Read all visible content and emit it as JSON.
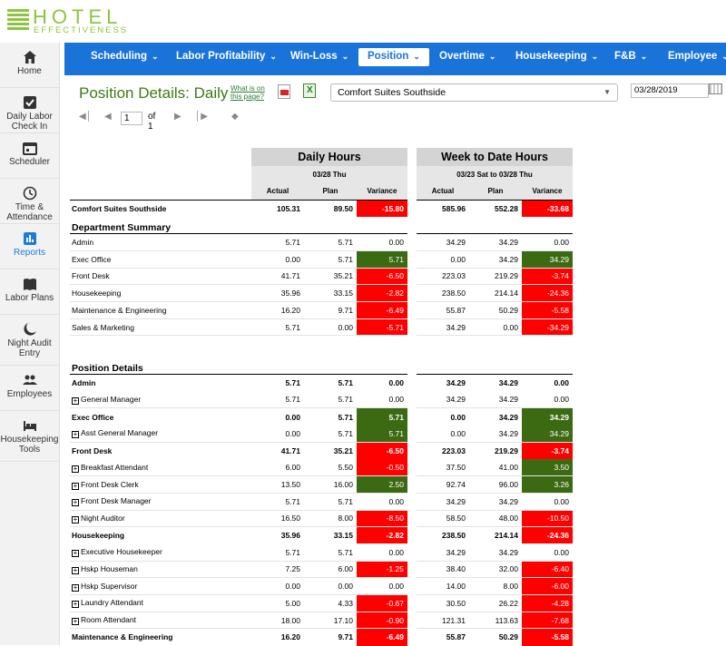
{
  "logo": {
    "title": "HOTEL",
    "subtitle": "EFFECTIVENESS"
  },
  "sidebar": [
    {
      "name": "home",
      "label": "Home"
    },
    {
      "name": "daily-labor-check-in",
      "label": "Daily Labor Check In"
    },
    {
      "name": "scheduler",
      "label": "Scheduler"
    },
    {
      "name": "time-attendance",
      "label": "Time & Attendance"
    },
    {
      "name": "reports",
      "label": "Reports"
    },
    {
      "name": "labor-plans",
      "label": "Labor Plans"
    },
    {
      "name": "night-audit-entry",
      "label": "Night Audit Entry"
    },
    {
      "name": "employees",
      "label": "Employees"
    },
    {
      "name": "housekeeping-tools",
      "label": "Housekeeping Tools"
    }
  ],
  "nav": {
    "scheduling": "Scheduling",
    "labor_profitability": "Labor Profitability",
    "win_loss": "Win-Loss",
    "position": "Position",
    "overtime": "Overtime",
    "housekeeping": "Housekeeping",
    "fb": "F&B",
    "employee": "Employee"
  },
  "page": {
    "title": "Position Details: Daily",
    "help_link": "What is on this page?",
    "property": "Comfort Suites Southside",
    "date": "03/28/2019"
  },
  "pager": {
    "page": "1",
    "of_label": "of 1"
  },
  "table": {
    "daily_title": "Daily Hours",
    "daily_date": "03/28 Thu",
    "wtd_title": "Week to Date Hours",
    "wtd_date": "03/23 Sat to 03/28 Thu",
    "col_actual": "Actual",
    "col_plan": "Plan",
    "col_variance": "Variance",
    "total": {
      "label": "Comfort Suites Southside",
      "v": [
        "105.31",
        "89.50",
        "-15.80",
        "585.96",
        "552.28",
        "-33.68"
      ]
    },
    "dept_summary_title": "Department Summary",
    "dept_summary": [
      {
        "label": "Admin",
        "v": [
          "5.71",
          "5.71",
          "0.00",
          "34.29",
          "34.29",
          "0.00"
        ]
      },
      {
        "label": "Exec Office",
        "v": [
          "0.00",
          "5.71",
          "5.71",
          "0.00",
          "34.29",
          "34.29"
        ]
      },
      {
        "label": "Front Desk",
        "v": [
          "41.71",
          "35.21",
          "-6.50",
          "223.03",
          "219.29",
          "-3.74"
        ]
      },
      {
        "label": "Housekeeping",
        "v": [
          "35.96",
          "33.15",
          "-2.82",
          "238.50",
          "214.14",
          "-24.36"
        ]
      },
      {
        "label": "Maintenance & Engineering",
        "v": [
          "16.20",
          "9.71",
          "-6.49",
          "55.87",
          "50.29",
          "-5.58"
        ]
      },
      {
        "label": "Sales & Marketing",
        "v": [
          "5.71",
          "0.00",
          "-5.71",
          "34.29",
          "0.00",
          "-34.29"
        ]
      }
    ],
    "position_details_title": "Position Details",
    "position_details": [
      {
        "label": "Admin",
        "dept": true,
        "v": [
          "5.71",
          "5.71",
          "0.00",
          "34.29",
          "34.29",
          "0.00"
        ]
      },
      {
        "label": "General Manager",
        "v": [
          "5.71",
          "5.71",
          "0.00",
          "34.29",
          "34.29",
          "0.00"
        ]
      },
      {
        "label": "Exec Office",
        "dept": true,
        "v": [
          "0.00",
          "5.71",
          "5.71",
          "0.00",
          "34.29",
          "34.29"
        ]
      },
      {
        "label": "Asst General Manager",
        "v": [
          "0.00",
          "5.71",
          "5.71",
          "0.00",
          "34.29",
          "34.29"
        ]
      },
      {
        "label": "Front Desk",
        "dept": true,
        "v": [
          "41.71",
          "35.21",
          "-6.50",
          "223.03",
          "219.29",
          "-3.74"
        ]
      },
      {
        "label": "Breakfast Attendant",
        "v": [
          "6.00",
          "5.50",
          "-0.50",
          "37.50",
          "41.00",
          "3.50"
        ]
      },
      {
        "label": "Front Desk Clerk",
        "v": [
          "13.50",
          "16.00",
          "2.50",
          "92.74",
          "96.00",
          "3.26"
        ]
      },
      {
        "label": "Front Desk Manager",
        "v": [
          "5.71",
          "5.71",
          "0.00",
          "34.29",
          "34.29",
          "0.00"
        ]
      },
      {
        "label": "Night Auditor",
        "v": [
          "16.50",
          "8.00",
          "-8.50",
          "58.50",
          "48.00",
          "-10.50"
        ]
      },
      {
        "label": "Housekeeping",
        "dept": true,
        "v": [
          "35.96",
          "33.15",
          "-2.82",
          "238.50",
          "214.14",
          "-24.36"
        ]
      },
      {
        "label": "Executive Housekeeper",
        "v": [
          "5.71",
          "5.71",
          "0.00",
          "34.29",
          "34.29",
          "0.00"
        ]
      },
      {
        "label": "Hskp Houseman",
        "v": [
          "7.25",
          "6.00",
          "-1.25",
          "38.40",
          "32.00",
          "-6.40"
        ]
      },
      {
        "label": "Hskp Supervisor",
        "v": [
          "0.00",
          "0.00",
          "0.00",
          "14.00",
          "8.00",
          "-6.00"
        ]
      },
      {
        "label": "Laundry Attendant",
        "v": [
          "5.00",
          "4.33",
          "-0.67",
          "30.50",
          "26.22",
          "-4.28"
        ]
      },
      {
        "label": "Room Attendant",
        "v": [
          "18.00",
          "17.10",
          "-0.90",
          "121.31",
          "113.63",
          "-7.68"
        ]
      },
      {
        "label": "Maintenance & Engineering",
        "dept": true,
        "v": [
          "16.20",
          "9.71",
          "-6.49",
          "55.87",
          "50.29",
          "-5.58"
        ]
      }
    ],
    "colors": {
      "over": "#ff0000",
      "under": "#3c6a12"
    }
  }
}
